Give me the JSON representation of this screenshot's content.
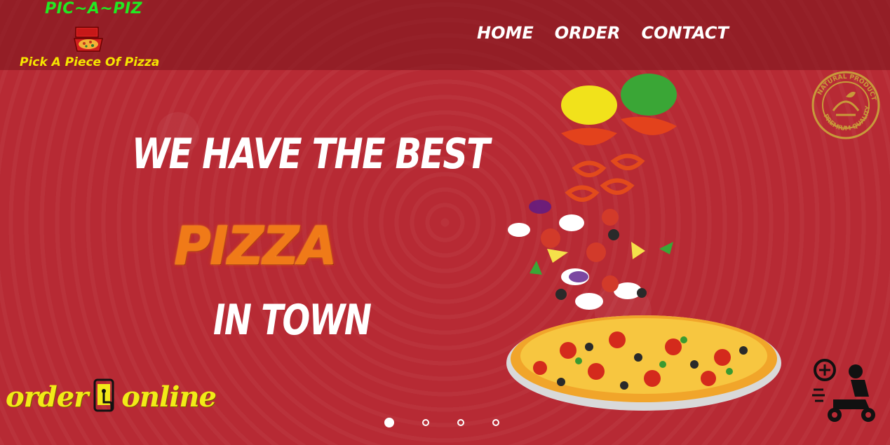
{
  "brand": {
    "title": "PIC~A~PIZ",
    "tagline": "Pick A Piece Of Pizza"
  },
  "nav": {
    "items": [
      "HOME",
      "ORDER",
      "CONTACT"
    ]
  },
  "hero": {
    "line1": "WE HAVE THE BEST",
    "line2": "PIZZA",
    "line3": "IN TOWN"
  },
  "order_online": {
    "word1": "order",
    "word2": "online"
  },
  "badge": {
    "text_top": "NATURAL PRODUCT",
    "text_bottom": "PREMIUM QUALITY"
  },
  "carousel": {
    "active_index": 0,
    "count": 4
  },
  "colors": {
    "background": "#b72a34",
    "brand_green": "#22e822",
    "brand_yellow": "#f6e600",
    "accent_orange": "#f07a18"
  }
}
